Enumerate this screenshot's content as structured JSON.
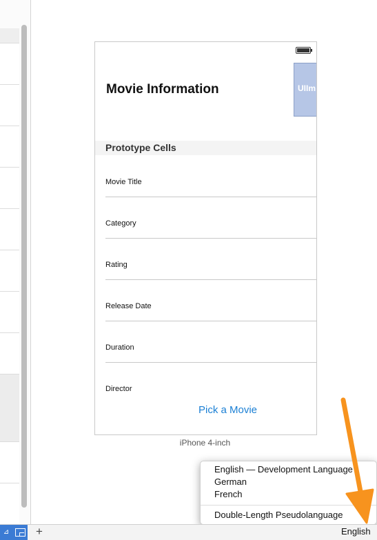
{
  "device": {
    "header_title": "Movie Information",
    "image_placeholder": "UIIm",
    "section_header": "Prototype Cells",
    "cells": [
      "Movie Title",
      "Category",
      "Rating",
      "Release Date",
      "Duration",
      "Director"
    ],
    "pick_button": "Pick a Movie",
    "label": "iPhone 4-inch"
  },
  "language_menu": {
    "items": [
      "English — Development Language",
      "German",
      "French"
    ],
    "extra_item": "Double-Length Pseudolanguage"
  },
  "bottom_bar": {
    "add": "+",
    "language": "English"
  },
  "colors": {
    "accent": "#1a7fd4",
    "arrow": "#f7931e",
    "image_view": "#b6c6e6"
  }
}
